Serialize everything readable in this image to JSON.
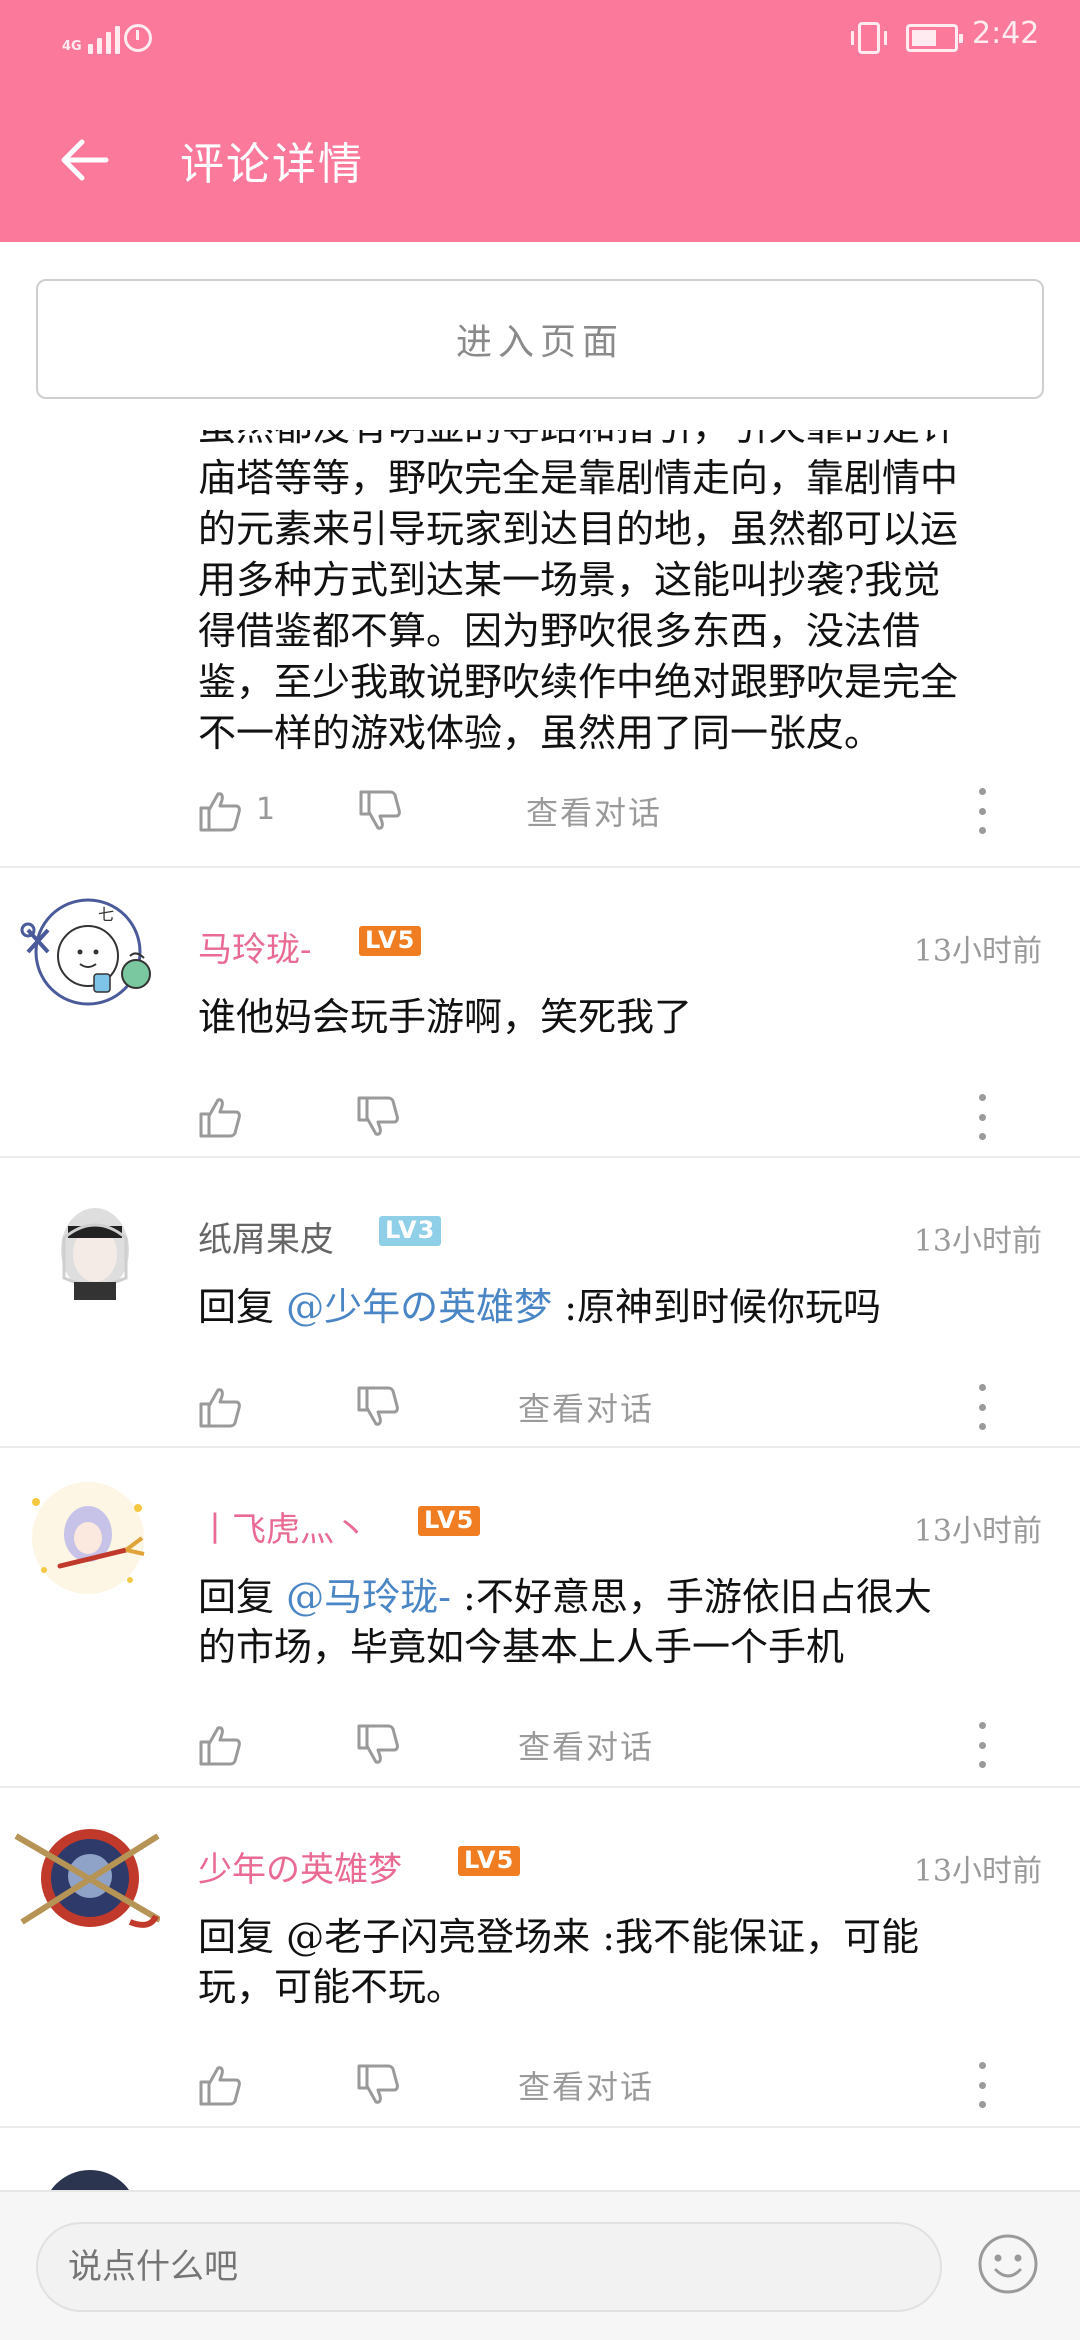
{
  "status_bar": {
    "network": "4G",
    "time": "2:42",
    "battery_level": 0.6
  },
  "header": {
    "title": "评论详情"
  },
  "enter_page": {
    "label": "进入页面"
  },
  "colors": {
    "accent": "#fb7a9c",
    "username_pink": "#e96a92",
    "level_orange": "#f07d21",
    "level_blue": "#8fd0e8",
    "mention_blue": "#4a86c5",
    "muted": "#9a9a9a"
  },
  "cut_comment": {
    "lines": [
      "虽然都没有明显的导路和指引，引火靠的是许",
      "庙塔等等，野吹完全是靠剧情走向，靠剧情中",
      "的元素来引导玩家到达目的地，虽然都可以运",
      "用多种方式到达某一场景，这能叫抄袭?我觉",
      "得借鉴都不算。因为野吹很多东西，没法借",
      "鉴，至少我敢说野吹续作中绝对跟野吹是完全",
      "不一样的游戏体验，虽然用了同一张皮。"
    ],
    "likes": "1",
    "view_conversation": "查看对话"
  },
  "comments": [
    {
      "username": "马玲珑-",
      "level": "LV5",
      "time": "13小时前",
      "reply_prefix": "",
      "mention": "",
      "text": "谁他妈会玩手游啊，笑死我了",
      "text2": "",
      "view_conversation": ""
    },
    {
      "username": "纸屑果皮",
      "level": "LV3",
      "time": "13小时前",
      "reply_prefix": "回复",
      "mention": "@少年の英雄梦",
      "text": ":原神到时候你玩吗",
      "text2": "",
      "view_conversation": "查看对话"
    },
    {
      "username": "丨飞虎灬丶",
      "level": "LV5",
      "time": "13小时前",
      "reply_prefix": "回复",
      "mention": "@马玲珑-",
      "text": ":不好意思，手游依旧占很大",
      "text2": "的市场，毕竟如今基本上人手一个手机",
      "view_conversation": "查看对话"
    },
    {
      "username": "少年の英雄梦",
      "level": "LV5",
      "time": "13小时前",
      "reply_prefix": "回复",
      "mention": "@老子闪亮登场来",
      "text": ":我不能保证，可能",
      "text2": "玩，可能不玩。",
      "view_conversation": "查看对话"
    },
    {
      "username": "",
      "level": "",
      "time": "",
      "reply_prefix": "",
      "mention": "",
      "text": "",
      "text2": "",
      "view_conversation": ""
    }
  ],
  "bottom_bar": {
    "placeholder": "说点什么吧"
  }
}
